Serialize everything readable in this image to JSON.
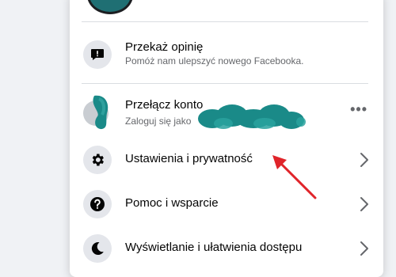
{
  "menu": {
    "feedback": {
      "title": "Przekaż opinię",
      "subtitle": "Pomóż nam ulepszyć nowego Facebooka."
    },
    "switch_account": {
      "title": "Przełącz konto",
      "subtitle": "Zaloguj się jako"
    },
    "items": [
      {
        "label": "Ustawienia i prywatność",
        "icon": "gear-icon"
      },
      {
        "label": "Pomoc i wsparcie",
        "icon": "question-icon"
      },
      {
        "label": "Wyświetlanie i ułatwienia dostępu",
        "icon": "moon-icon"
      }
    ]
  },
  "colors": {
    "panel": "#ffffff",
    "icon_bg": "#e4e6eb",
    "redaction": "#1a8a88",
    "annotation_arrow": "#e0242a"
  }
}
